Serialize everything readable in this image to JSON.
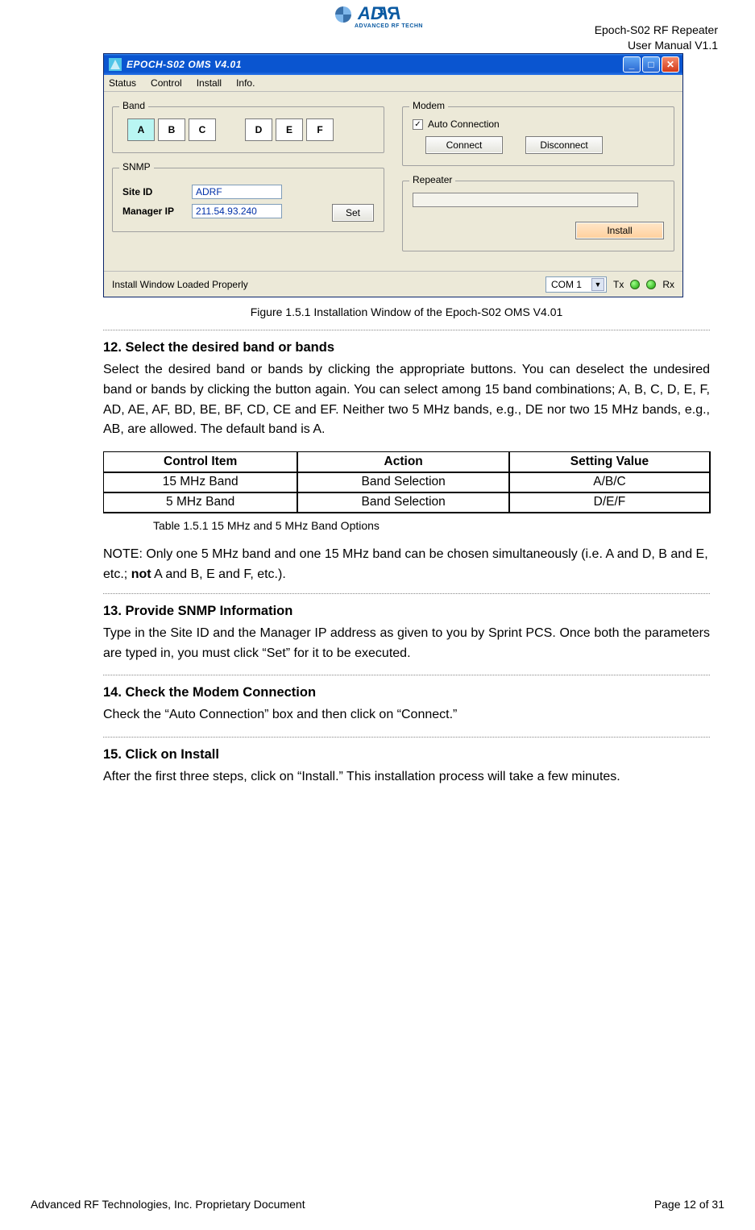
{
  "header": {
    "product": "Epoch-S02 RF Repeater",
    "doc": "User Manual V1.1",
    "logo_sub": "ADVANCED RF TECHNOLOGIES"
  },
  "screenshot": {
    "title": "EPOCH-S02 OMS V4.01",
    "menu": {
      "status": "Status",
      "control": "Control",
      "install": "Install",
      "info": "Info."
    },
    "band_group": "Band",
    "bands": {
      "a": "A",
      "b": "B",
      "c": "C",
      "d": "D",
      "e": "E",
      "f": "F"
    },
    "snmp_group": "SNMP",
    "snmp": {
      "site_id_label": "Site ID",
      "manager_ip_label": "Manager IP",
      "site_id": "ADRF",
      "manager_ip": "211.54.93.240"
    },
    "set_btn": "Set",
    "modem_group": "Modem",
    "modem": {
      "auto": "Auto Connection",
      "connect": "Connect",
      "disconnect": "Disconnect"
    },
    "repeater_group": "Repeater",
    "install_btn": "Install",
    "statusbar": "Install Window Loaded Properly",
    "com": "COM 1",
    "tx": "Tx",
    "rx": "Rx"
  },
  "figure_caption": "Figure 1.5.1 Installation Window of the Epoch-S02 OMS V4.01",
  "step12": {
    "title": "12. Select the desired band or bands",
    "body": "Select the desired band or bands by clicking the appropriate buttons.  You can deselect the undesired band or bands by clicking the button again.  You can select among 15 band combinations; A, B, C, D, E, F, AD, AE, AF, BD, BE, BF, CD, CE and EF.  Neither two 5 MHz bands, e.g., DE nor two 15 MHz bands, e.g., AB, are allowed.  The default band is A."
  },
  "table": {
    "headers": {
      "c1": "Control Item",
      "c2": "Action",
      "c3": "Setting Value"
    },
    "rows": [
      {
        "c1": "15 MHz Band",
        "c2": "Band Selection",
        "c3": "A/B/C"
      },
      {
        "c1": "5 MHz Band",
        "c2": "Band Selection",
        "c3": "D/E/F"
      }
    ],
    "caption": "Table 1.5.1 15 MHz and 5 MHz Band Options"
  },
  "note": {
    "pre": "NOTE:  Only one 5 MHz band and one 15 MHz band can be chosen simultaneously (i.e. A and D, B and E, etc.; ",
    "bold": "not",
    "post": " A and B, E and F, etc.)."
  },
  "step13": {
    "title": "13. Provide SNMP Information",
    "body": "Type in the Site ID and the Manager IP address as given to you by Sprint PCS.  Once both the parameters are typed in, you must click “Set” for it to be executed."
  },
  "step14": {
    "title": "14. Check the Modem Connection",
    "body": "Check the “Auto Connection” box and then click on “Connect.”"
  },
  "step15": {
    "title": "15.  Click on Install",
    "body": "After the first three steps, click on “Install.”  This installation process will take a few minutes."
  },
  "footer": {
    "left": "Advanced RF Technologies, Inc. Proprietary Document",
    "right": "Page 12 of 31"
  }
}
